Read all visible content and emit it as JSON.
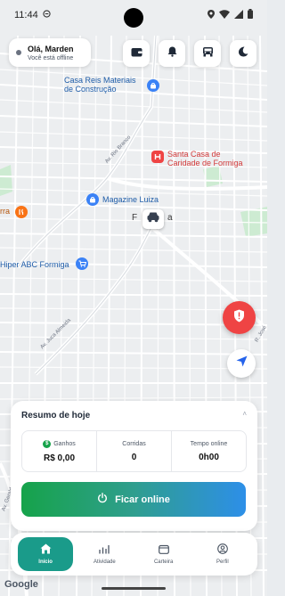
{
  "status_bar": {
    "time": "11:44"
  },
  "greeting": {
    "name": "Olá, Marden",
    "status": "Você está offline"
  },
  "top_actions": [
    {
      "icon": "wallet-icon"
    },
    {
      "icon": "bell-icon"
    },
    {
      "icon": "car-front-icon"
    },
    {
      "icon": "moon-icon"
    }
  ],
  "map": {
    "places": {
      "casa_reis_line1": "Casa Reis Materiais",
      "casa_reis_line2": "de Construção",
      "santa_casa_line1": "Santa Casa de",
      "santa_casa_line2": "Caridade de Formiga",
      "magazine_luiza": "Magazine Luiza",
      "hiper_abc": "Hiper ABC Formiga",
      "formiga_left": "F",
      "formiga_right": "a",
      "rra": "rra"
    },
    "roads": {
      "rio_branco": "Av. Rio Branco",
      "juca_almeida": "Av. Juca Almeida",
      "jose": "R. José",
      "geraldo": "Av. Geraldo"
    },
    "colors": {
      "background": "#eceef0",
      "roads": "#ffffff",
      "park": "#cdebd2"
    }
  },
  "summary": {
    "title": "Resumo de hoje",
    "collapse_icon": "˄",
    "stats": [
      {
        "label": "Ganhos",
        "value": "R$ 0,00",
        "icon": "dollar-coin-icon"
      },
      {
        "label": "Corridas",
        "value": "0"
      },
      {
        "label": "Tempo online",
        "value": "0h00"
      }
    ],
    "online_button": "Ficar online"
  },
  "nav": [
    {
      "label": "Início",
      "icon": "home-icon",
      "active": true
    },
    {
      "label": "Atividade",
      "icon": "chart-icon",
      "active": false
    },
    {
      "label": "Carteira",
      "icon": "wallet-icon",
      "active": false
    },
    {
      "label": "Perfil",
      "icon": "user-icon",
      "active": false
    }
  ],
  "footer": {
    "google": "Google"
  },
  "colors": {
    "accent": "#1a9b8a",
    "alert": "#ef4444",
    "online_gradient": [
      "#16a34a",
      "#2d8fe8"
    ]
  }
}
